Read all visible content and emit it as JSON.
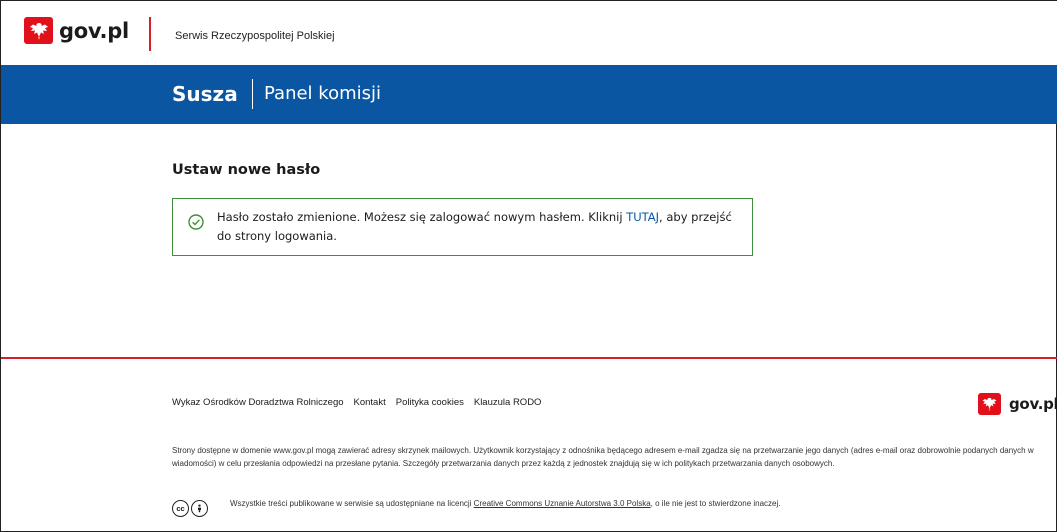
{
  "header": {
    "logo_text": "gov.pl",
    "service_name": "Serwis Rzeczypospolitej Polskiej"
  },
  "app": {
    "title": "Susza",
    "subtitle": "Panel komisji"
  },
  "main": {
    "heading": "Ustaw nowe hasło",
    "alert": {
      "text_before": "Hasło zostało zmienione. Możesz się zalogować nowym hasłem. Kliknij ",
      "link_text": "TUTAJ",
      "text_after": ", aby przejść do strony logowania."
    }
  },
  "footer": {
    "links": [
      "Wykaz Ośrodków Doradztwa Rolniczego",
      "Kontakt",
      "Polityka cookies",
      "Klauzula RODO"
    ],
    "logo_text": "gov.pl",
    "disclaimer": "Strony dostępne w domenie www.gov.pl mogą zawierać adresy skrzynek mailowych. Użytkownik korzystający z odnośnika będącego adresem e-mail zgadza się na przetwarzanie jego danych (adres e-mail oraz dobrowolnie podanych danych w wiadomości) w celu przesłania odpowiedzi na przesłane pytania. Szczegóły przetwarzania danych przez każdą z jednostek znajdują się w ich politykach przetwarzania danych osobowych.",
    "license_before": "Wszystkie treści publikowane w serwisie są udostępniane na licencji ",
    "license_link": "Creative Commons Uznanie Autorstwa 3.0 Polska",
    "license_after": ", o ile nie jest to stwierdzone inaczej.",
    "cc_label": "cc"
  },
  "colors": {
    "brand_blue": "#0b56a3",
    "brand_red": "#d4202b",
    "success_green": "#3f8f3a"
  }
}
